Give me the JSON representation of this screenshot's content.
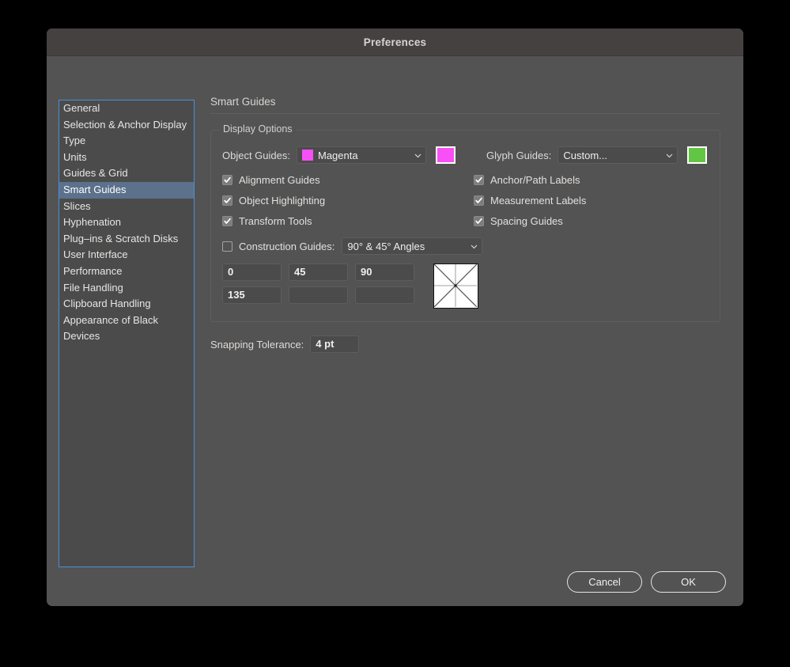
{
  "window": {
    "title": "Preferences"
  },
  "sidebar": {
    "items": [
      {
        "label": "General",
        "selected": false
      },
      {
        "label": "Selection & Anchor Display",
        "selected": false
      },
      {
        "label": "Type",
        "selected": false
      },
      {
        "label": "Units",
        "selected": false
      },
      {
        "label": "Guides & Grid",
        "selected": false
      },
      {
        "label": "Smart Guides",
        "selected": true
      },
      {
        "label": "Slices",
        "selected": false
      },
      {
        "label": "Hyphenation",
        "selected": false
      },
      {
        "label": "Plug–ins & Scratch Disks",
        "selected": false
      },
      {
        "label": "User Interface",
        "selected": false
      },
      {
        "label": "Performance",
        "selected": false
      },
      {
        "label": "File Handling",
        "selected": false
      },
      {
        "label": "Clipboard Handling",
        "selected": false
      },
      {
        "label": "Appearance of Black",
        "selected": false
      },
      {
        "label": "Devices",
        "selected": false
      }
    ]
  },
  "pane": {
    "heading": "Smart Guides",
    "group_title": "Display Options",
    "object_guides": {
      "label": "Object Guides:",
      "value": "Magenta",
      "chip_color": "#f64ff4",
      "swatch_color": "#f84ff6"
    },
    "glyph_guides": {
      "label": "Glyph Guides:",
      "value": "Custom...",
      "swatch_color": "#62c543"
    },
    "checkboxes_left": [
      {
        "label": "Alignment Guides",
        "checked": true
      },
      {
        "label": "Object Highlighting",
        "checked": true
      },
      {
        "label": "Transform Tools",
        "checked": true
      }
    ],
    "checkboxes_right": [
      {
        "label": "Anchor/Path Labels",
        "checked": true
      },
      {
        "label": "Measurement Labels",
        "checked": true
      },
      {
        "label": "Spacing Guides",
        "checked": true
      }
    ],
    "construction_guides": {
      "label": "Construction Guides:",
      "checked": false,
      "value": "90° & 45° Angles"
    },
    "angles": [
      "0",
      "45",
      "90",
      "135",
      "",
      ""
    ],
    "snapping_tolerance": {
      "label": "Snapping Tolerance:",
      "value": "4 pt"
    }
  },
  "footer": {
    "cancel_label": "Cancel",
    "ok_label": "OK"
  }
}
